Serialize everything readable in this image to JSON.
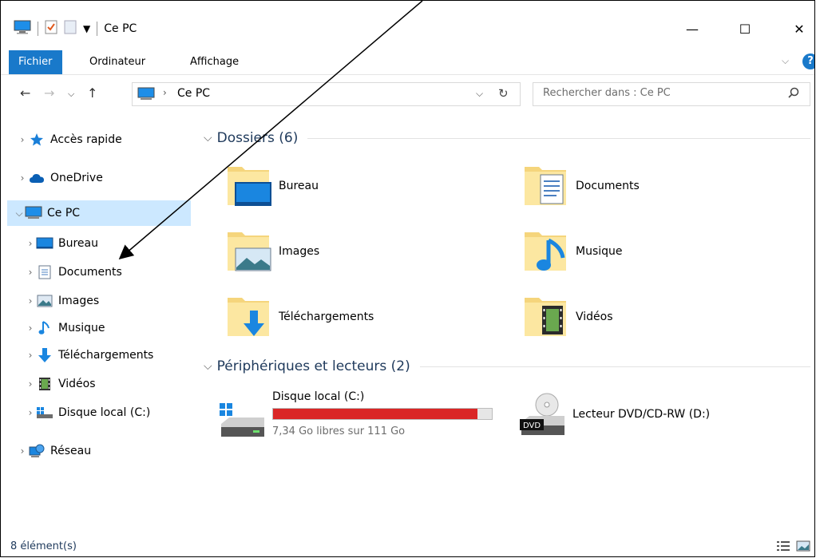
{
  "window": {
    "title": "Ce PC",
    "minimize_glyph": "—",
    "maximize_glyph": "☐",
    "close_glyph": "✕"
  },
  "ribbon": {
    "tabs": [
      "Fichier",
      "Ordinateur",
      "Affichage"
    ]
  },
  "address": {
    "path_label": "Ce PC",
    "search_placeholder": "Rechercher dans : Ce PC"
  },
  "nav": {
    "items": [
      {
        "label": "Accès rapide",
        "icon": "star-icon"
      },
      {
        "label": "OneDrive",
        "icon": "cloud-icon"
      },
      {
        "label": "Ce PC",
        "icon": "computer-icon",
        "selected": true
      },
      {
        "label": "Bureau",
        "icon": "desktop-icon"
      },
      {
        "label": "Documents",
        "icon": "documents-icon"
      },
      {
        "label": "Images",
        "icon": "images-icon"
      },
      {
        "label": "Musique",
        "icon": "music-icon"
      },
      {
        "label": "Téléchargements",
        "icon": "download-icon"
      },
      {
        "label": "Vidéos",
        "icon": "video-icon"
      },
      {
        "label": "Disque local (C:)",
        "icon": "drive-icon"
      },
      {
        "label": "Réseau",
        "icon": "network-icon"
      }
    ]
  },
  "content": {
    "folders_header": "Dossiers (6)",
    "folders": [
      {
        "label": "Bureau",
        "icon": "desktop-folder-icon"
      },
      {
        "label": "Documents",
        "icon": "documents-folder-icon"
      },
      {
        "label": "Images",
        "icon": "images-folder-icon"
      },
      {
        "label": "Musique",
        "icon": "music-folder-icon"
      },
      {
        "label": "Téléchargements",
        "icon": "downloads-folder-icon"
      },
      {
        "label": "Vidéos",
        "icon": "videos-folder-icon"
      }
    ],
    "devices_header": "Périphériques et lecteurs (2)",
    "drive_c": {
      "label": "Disque local (C:)",
      "free_text": "7,34 Go libres sur 111 Go",
      "used_fraction": 0.934,
      "bar_color": "#da2626"
    },
    "dvd": {
      "label": "Lecteur DVD/CD-RW (D:)",
      "badge": "DVD"
    }
  },
  "status": {
    "count": "8 élément(s)"
  },
  "colors": {
    "accent": "#1979ca",
    "selection": "#cce8ff",
    "header_text": "#1e395b"
  }
}
